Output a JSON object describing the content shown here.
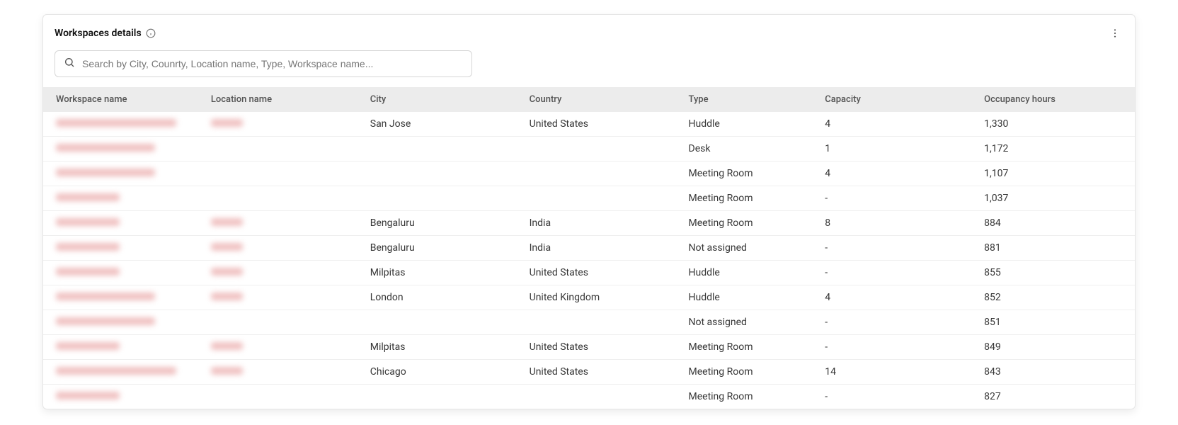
{
  "header": {
    "title": "Workspaces details"
  },
  "search": {
    "placeholder": "Search by City, Counrty, Location name, Type, Workspace name...",
    "value": ""
  },
  "table": {
    "columns": {
      "workspace_name": "Workspace name",
      "location_name": "Location name",
      "city": "City",
      "country": "Country",
      "type": "Type",
      "capacity": "Capacity",
      "occupancy_hours": "Occupancy hours"
    },
    "rows": [
      {
        "city": "San Jose",
        "country": "United States",
        "type": "Huddle",
        "capacity": "4",
        "occupancy_hours": "1,330"
      },
      {
        "city": "",
        "country": "",
        "type": "Desk",
        "capacity": "1",
        "occupancy_hours": "1,172"
      },
      {
        "city": "",
        "country": "",
        "type": "Meeting Room",
        "capacity": "4",
        "occupancy_hours": "1,107"
      },
      {
        "city": "",
        "country": "",
        "type": "Meeting Room",
        "capacity": "-",
        "occupancy_hours": "1,037"
      },
      {
        "city": "Bengaluru",
        "country": "India",
        "type": "Meeting Room",
        "capacity": "8",
        "occupancy_hours": "884"
      },
      {
        "city": "Bengaluru",
        "country": "India",
        "type": "Not assigned",
        "capacity": "-",
        "occupancy_hours": "881"
      },
      {
        "city": "Milpitas",
        "country": "United States",
        "type": "Huddle",
        "capacity": "-",
        "occupancy_hours": "855"
      },
      {
        "city": "London",
        "country": "United Kingdom",
        "type": "Huddle",
        "capacity": "4",
        "occupancy_hours": "852"
      },
      {
        "city": "",
        "country": "",
        "type": "Not assigned",
        "capacity": "-",
        "occupancy_hours": "851"
      },
      {
        "city": "Milpitas",
        "country": "United States",
        "type": "Meeting Room",
        "capacity": "-",
        "occupancy_hours": "849"
      },
      {
        "city": "Chicago",
        "country": "United States",
        "type": "Meeting Room",
        "capacity": "14",
        "occupancy_hours": "843"
      },
      {
        "city": "",
        "country": "",
        "type": "Meeting Room",
        "capacity": "-",
        "occupancy_hours": "827"
      }
    ]
  }
}
